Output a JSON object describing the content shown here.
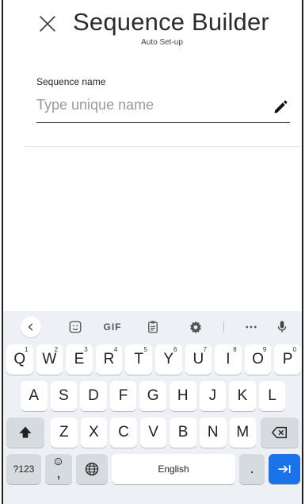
{
  "header": {
    "title": "Sequence Builder",
    "subtitle": "Auto Set-up"
  },
  "form": {
    "label": "Sequence name",
    "placeholder": "Type unique name"
  },
  "keyboard": {
    "toolbar": {
      "gif_label": "GIF"
    },
    "row1": [
      {
        "key": "Q",
        "hint": "1"
      },
      {
        "key": "W",
        "hint": "2"
      },
      {
        "key": "E",
        "hint": "3"
      },
      {
        "key": "R",
        "hint": "4"
      },
      {
        "key": "T",
        "hint": "5"
      },
      {
        "key": "Y",
        "hint": "6"
      },
      {
        "key": "U",
        "hint": "7"
      },
      {
        "key": "I",
        "hint": "8"
      },
      {
        "key": "O",
        "hint": "9"
      },
      {
        "key": "P",
        "hint": "0"
      }
    ],
    "row2": [
      "A",
      "S",
      "D",
      "F",
      "G",
      "H",
      "J",
      "K",
      "L"
    ],
    "row3": [
      "Z",
      "X",
      "C",
      "V",
      "B",
      "N",
      "M"
    ],
    "symbols_label": "?123",
    "emoji_comma_label": ",",
    "space_label": "English",
    "period_label": ".",
    "colors": {
      "accent": "#1a73e8",
      "keyboard_bg": "#edf0f4"
    }
  }
}
